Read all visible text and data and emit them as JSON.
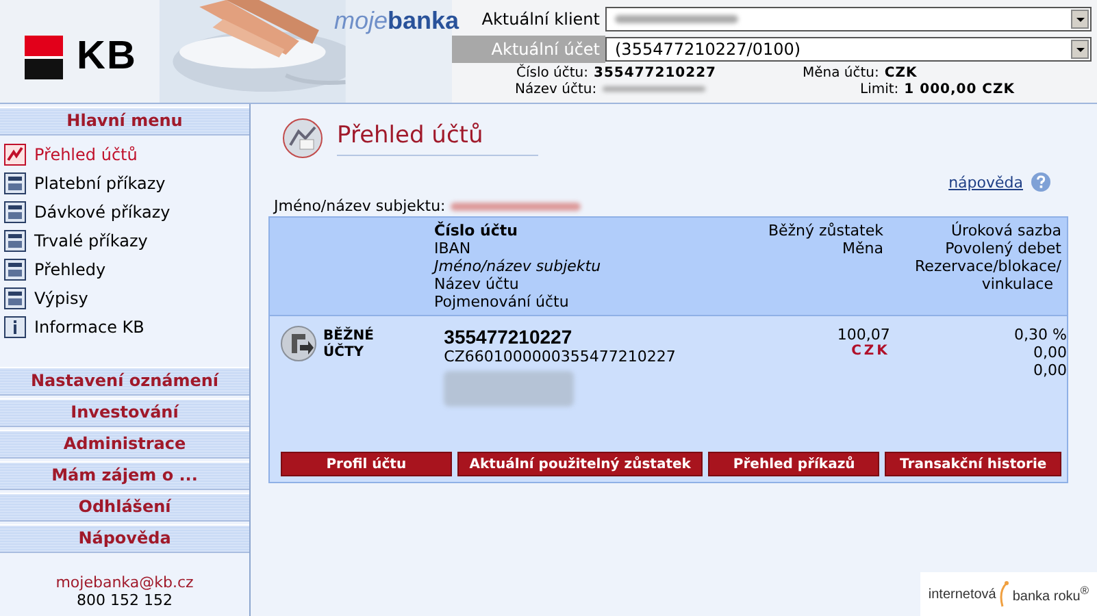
{
  "header": {
    "brand": "KB",
    "product_prefix": "moje",
    "product_suffix": "banka",
    "client_label": "Aktuální klient",
    "account_label": "Aktuální účet",
    "account_value": "(355477210227/0100)",
    "info": [
      {
        "label": "Číslo účtu:",
        "kind": "text",
        "value": "355477210227"
      },
      {
        "label": "Měna účtu:",
        "kind": "text",
        "value": "CZK"
      },
      {
        "label": "Název účtu:",
        "kind": "redacted"
      },
      {
        "label": "Limit:",
        "kind": "text",
        "value": "1 000,00 CZK"
      }
    ]
  },
  "sidebar": {
    "title": "Hlavní menu",
    "items": [
      {
        "label": "Přehled účtů",
        "selected": true
      },
      {
        "label": "Platební příkazy",
        "selected": false
      },
      {
        "label": "Dávkové příkazy",
        "selected": false
      },
      {
        "label": "Trvalé příkazy",
        "selected": false
      },
      {
        "label": "Přehledy",
        "selected": false
      },
      {
        "label": "Výpisy",
        "selected": false
      },
      {
        "label": "Informace KB",
        "selected": false
      }
    ],
    "sections": [
      "Nastavení oznámení",
      "Investování",
      "Administrace",
      "Mám zájem o ...",
      "Odhlášení",
      "Nápověda"
    ],
    "contact": {
      "email": "mojebanka@kb.cz",
      "phone": "800 152 152"
    }
  },
  "content": {
    "title": "Přehled účtů",
    "help_link": "nápověda",
    "subject_label": "Jméno/název subjektu:",
    "table": {
      "columns": [
        [
          {
            "text": "Číslo účtu",
            "kind": "bold"
          },
          {
            "text": "IBAN",
            "kind": "plain"
          },
          {
            "text": "Jméno/název subjektu",
            "kind": "italic"
          },
          {
            "text": "Název účtu",
            "kind": "plain"
          },
          {
            "text": "Pojmenování účtu",
            "kind": "plain"
          }
        ],
        [
          "Běžný zůstatek",
          "Měna"
        ],
        [
          "Úroková sazba",
          "Povolený debet",
          "Rezervace/blokace/",
          "vinkulace"
        ]
      ],
      "group_label": "BĚŽNÉ ÚČTY",
      "account": {
        "number": "355477210227",
        "iban": "CZ6601000000355477210227",
        "balance": "100,07",
        "currency": "CZK",
        "rate": "0,30 %",
        "debit": "0,00",
        "reserve": "0,00"
      },
      "buttons": [
        "Profil účtu",
        "Aktuální použitelný zůstatek",
        "Přehled příkazů",
        "Transakční historie"
      ]
    }
  },
  "badge": {
    "left": "internetová",
    "right": "banka roku$^{®}$"
  }
}
